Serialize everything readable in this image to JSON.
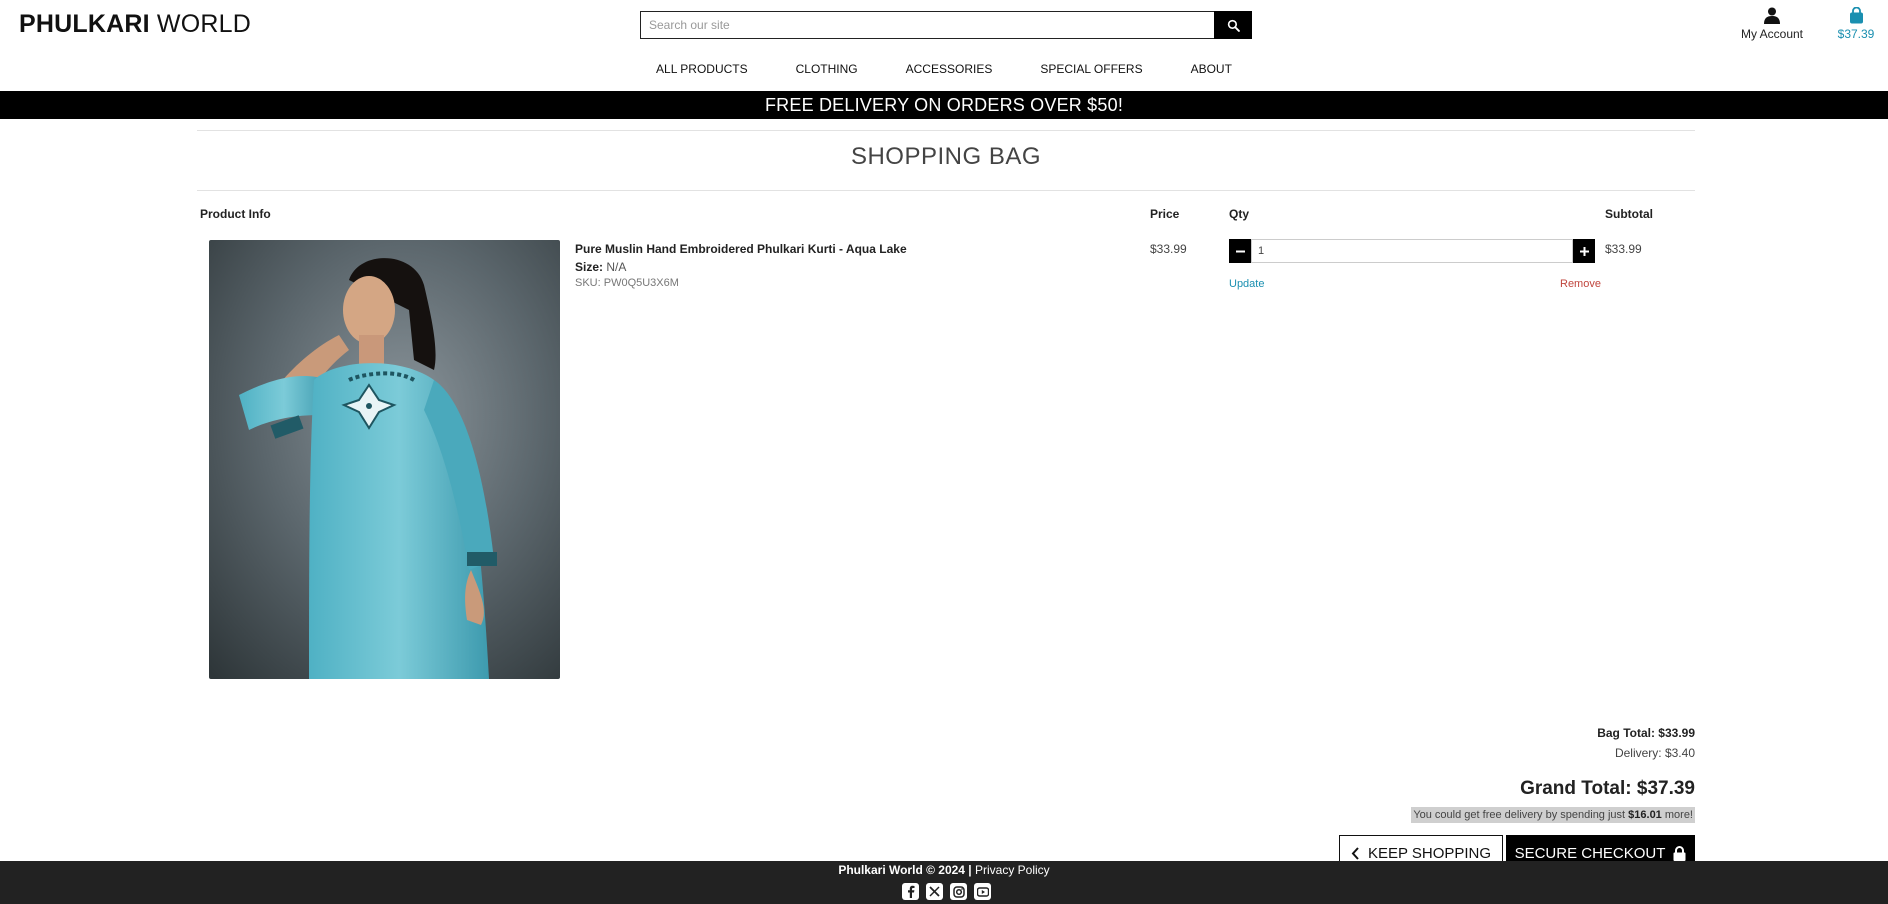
{
  "header": {
    "logo_strong": "PHULKARI",
    "logo_rest": " WORLD",
    "search_placeholder": "Search our site",
    "account_label": "My Account",
    "bag_total": "$37.39"
  },
  "nav": [
    {
      "label": "ALL PRODUCTS"
    },
    {
      "label": "CLOTHING"
    },
    {
      "label": "ACCESSORIES"
    },
    {
      "label": "SPECIAL OFFERS"
    },
    {
      "label": "ABOUT"
    }
  ],
  "banner": "FREE DELIVERY ON ORDERS OVER $50!",
  "page_title": "SHOPPING BAG",
  "table_headers": {
    "product_info": "Product Info",
    "price": "Price",
    "qty": "Qty",
    "subtotal": "Subtotal"
  },
  "item": {
    "name": "Pure Muslin Hand Embroidered Phulkari Kurti - Aqua Lake",
    "size_label": "Size:",
    "size_value": "N/A",
    "sku": "SKU: PW0Q5U3X6M",
    "price": "$33.99",
    "qty": "1",
    "update_label": "Update",
    "remove_label": "Remove",
    "subtotal": "$33.99"
  },
  "totals": {
    "bag_total": "Bag Total: $33.99",
    "delivery": "Delivery: $3.40",
    "grand_total": "Grand Total: $37.39",
    "free_msg_prefix": "You could get free delivery by spending just ",
    "free_msg_amount": "$16.01",
    "free_msg_suffix": " more!"
  },
  "buttons": {
    "keep_shopping": "KEEP SHOPPING",
    "secure_checkout": "SECURE CHECKOUT"
  },
  "footer": {
    "copyright": "Phulkari World © 2024 | ",
    "privacy": "Privacy Policy",
    "socials": [
      "facebook-icon",
      "x-icon",
      "instagram-icon",
      "youtube-icon"
    ]
  },
  "colors": {
    "accent": "#1a8fb0",
    "remove": "#c0453d",
    "banner_bg": "#000000",
    "footer_bg": "#222222"
  }
}
